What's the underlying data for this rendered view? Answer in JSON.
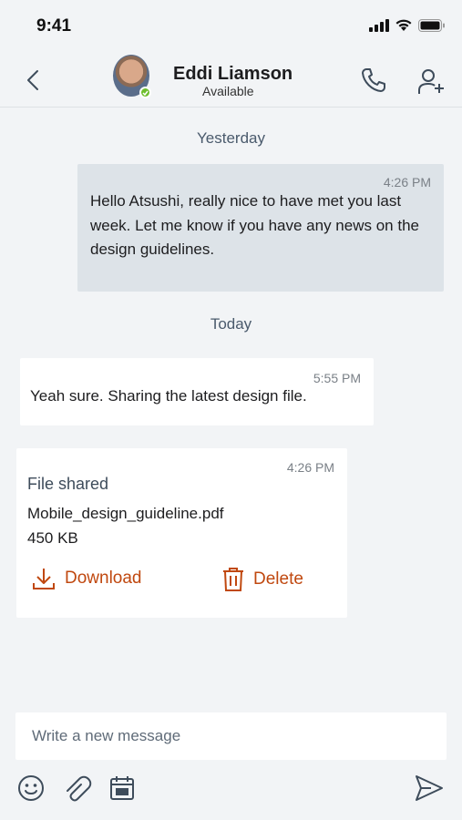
{
  "status_bar": {
    "time": "9:41"
  },
  "header": {
    "contact_name": "Eddi Liamson",
    "contact_status": "Available",
    "presence_color": "#6ebe2c"
  },
  "conversation": {
    "date_yesterday": "Yesterday",
    "date_today": "Today",
    "outgoing_message": {
      "time": "4:26 PM",
      "text": "Hello Atsushi, really nice to have met you last week. Let me know if you have any news on the design guidelines."
    },
    "incoming_message": {
      "time": "5:55 PM",
      "text": "Yeah sure. Sharing the latest design file."
    },
    "file_card": {
      "time": "4:26 PM",
      "title": "File shared",
      "file_name": "Mobile_design_guideline.pdf",
      "file_size": "450 KB",
      "download_label": "Download",
      "delete_label": "Delete",
      "accent_color": "#c0480f"
    }
  },
  "composer": {
    "placeholder": "Write a new message"
  },
  "toolbar": {
    "icons": [
      "emoji-icon",
      "attachment-icon",
      "calendar-icon",
      "send-icon"
    ]
  }
}
